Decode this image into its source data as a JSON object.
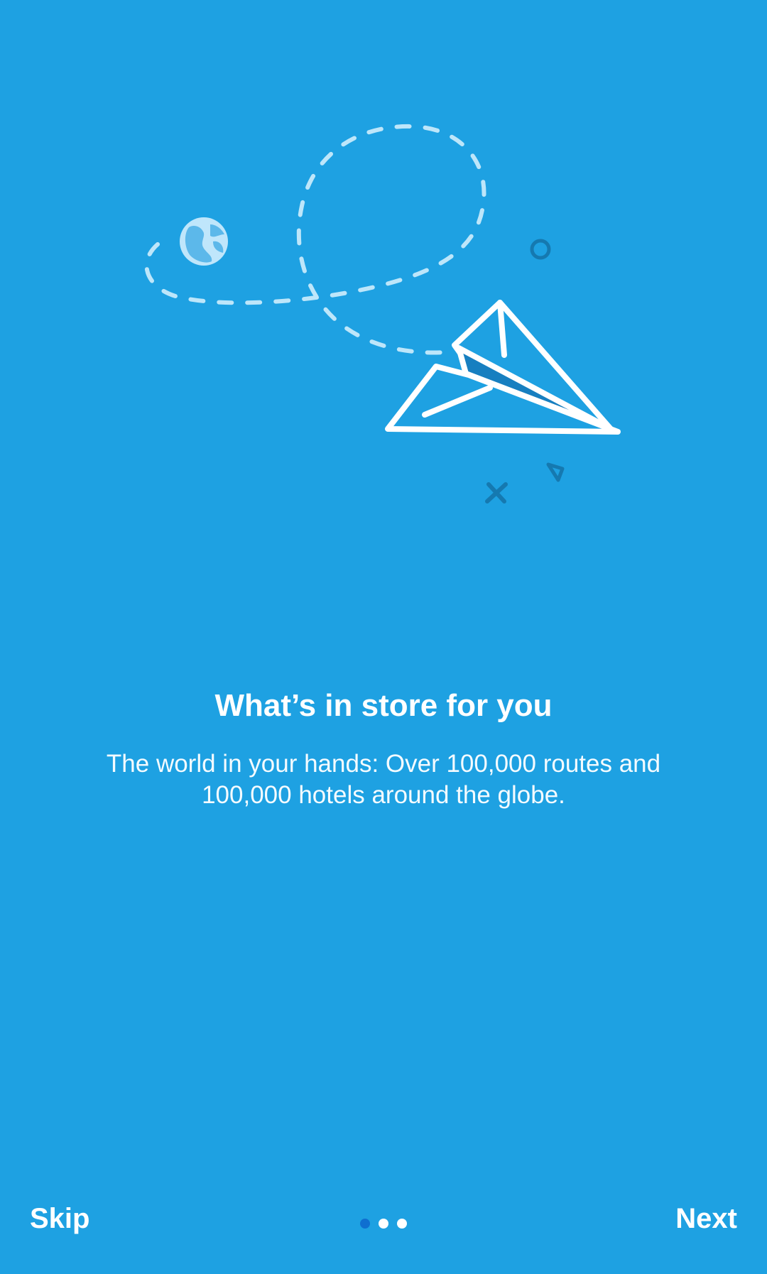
{
  "onboarding": {
    "title": "What’s in store for you",
    "description": "The world in your hands: Over 100,000 routes and 100,000 hotels around the globe.",
    "page_indicator": {
      "total": 3,
      "current": 1
    }
  },
  "navigation": {
    "skip_label": "Skip",
    "next_label": "Next"
  },
  "colors": {
    "background": "#1ea1e2",
    "active_dot": "#0f6fd0",
    "inactive_dot": "#ffffff",
    "text": "#ffffff"
  },
  "icons": {
    "illustration": "paper-plane-globe-illustration",
    "globe": "globe-icon",
    "plane": "paper-plane-icon"
  }
}
